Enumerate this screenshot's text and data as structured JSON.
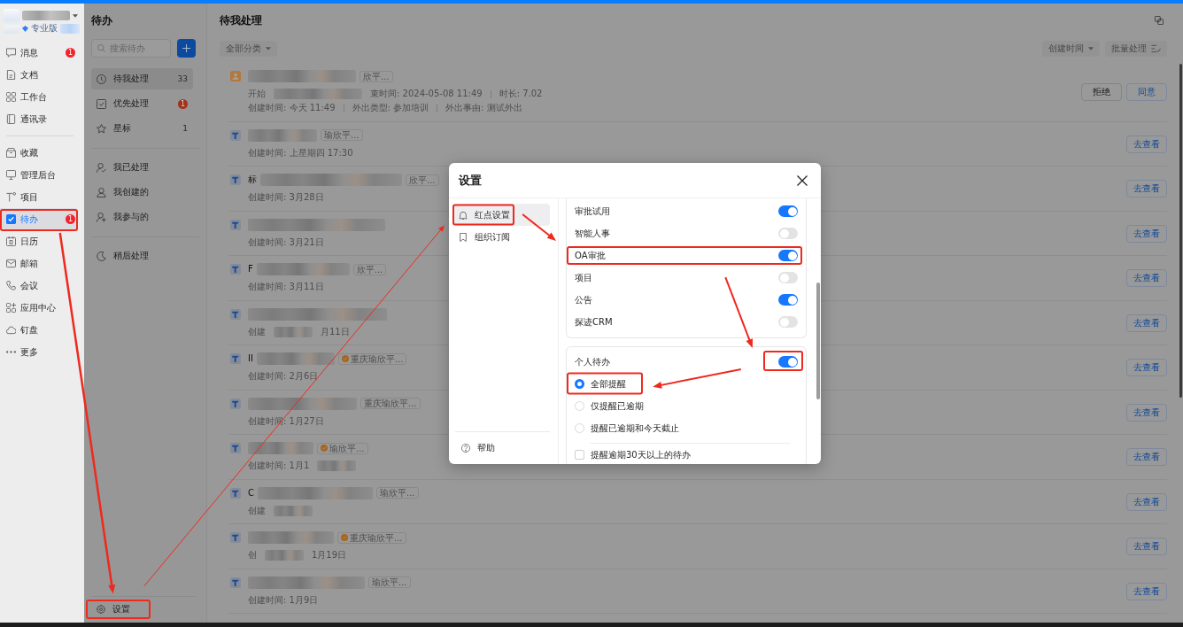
{
  "org": {
    "edition": "专业版"
  },
  "sidebar": {
    "groups": [
      [
        {
          "label": "消息",
          "badge": "1",
          "selected": false,
          "highlighted": false
        },
        {
          "label": "文档",
          "selected": false,
          "highlighted": false
        },
        {
          "label": "工作台",
          "selected": false,
          "highlighted": false
        },
        {
          "label": "通讯录",
          "selected": false,
          "highlighted": false
        }
      ],
      [
        {
          "label": "收藏",
          "selected": false,
          "highlighted": false
        },
        {
          "label": "管理后台",
          "selected": false,
          "highlighted": false
        },
        {
          "label": "项目",
          "selected": false,
          "highlighted": false
        },
        {
          "label": "待办",
          "badge": "1",
          "selected": true,
          "highlighted": true
        },
        {
          "label": "日历",
          "selected": false,
          "highlighted": false
        },
        {
          "label": "邮箱",
          "selected": false,
          "highlighted": false
        },
        {
          "label": "会议",
          "selected": false,
          "highlighted": false
        },
        {
          "label": "应用中心",
          "selected": false,
          "highlighted": false
        },
        {
          "label": "钉盘",
          "selected": false,
          "highlighted": false
        },
        {
          "label": "更多",
          "selected": false,
          "highlighted": false
        }
      ]
    ]
  },
  "todo_nav": {
    "title": "待办",
    "search": {
      "placeholder": "搜索待办"
    },
    "groups": [
      [
        {
          "label": "待我处理",
          "count": "33",
          "selected": true
        },
        {
          "label": "优先处理",
          "badge": "1",
          "selected": false
        },
        {
          "label": "星标",
          "count": "1",
          "selected": false
        }
      ],
      [
        {
          "label": "我已处理",
          "selected": false
        },
        {
          "label": "我创建的",
          "selected": false
        },
        {
          "label": "我参与的",
          "selected": false
        }
      ],
      [
        {
          "label": "稍后处理",
          "selected": false
        }
      ]
    ],
    "settings": {
      "label": "设置",
      "highlighted": true
    }
  },
  "main": {
    "title": "待我处理",
    "filter": "全部分类",
    "sort": "创建时间",
    "batch": "批量处理",
    "rows": [
      {
        "kind": "person",
        "title": [
          {
            "kind": "blur"
          }
        ],
        "tag": {
          "text": "欣平...",
          "org": false
        },
        "meta": [
          [
            {
              "kind": "text",
              "text": "开始"
            },
            {
              "kind": "blur"
            },
            {
              "kind": "text",
              "text": "束时间: 2024-05-08 11:49"
            },
            {
              "kind": "sep"
            },
            {
              "kind": "text",
              "text": "时长: 7.02"
            }
          ],
          [
            {
              "kind": "text",
              "text": "创建时间: 今天 11:49"
            },
            {
              "kind": "sep"
            },
            {
              "kind": "text",
              "text": "外出类型: 参加培训"
            },
            {
              "kind": "sep"
            },
            {
              "kind": "text",
              "text": "外出事由: 测试外出"
            }
          ]
        ],
        "actions": [
          {
            "label": "拒绝",
            "kind": "default"
          },
          {
            "label": "同意",
            "kind": "primary"
          }
        ]
      },
      {
        "kind": "app",
        "title": [
          {
            "kind": "blur"
          }
        ],
        "tag": {
          "text": "瑜欣平...",
          "org": false
        },
        "meta": [
          [
            {
              "kind": "text",
              "text": "创建时间: 上星期四 17:30"
            }
          ]
        ],
        "actions": [
          {
            "label": "去查看",
            "kind": "primary"
          }
        ]
      },
      {
        "kind": "app",
        "title": [
          {
            "kind": "text",
            "text": "标"
          },
          {
            "kind": "blur"
          }
        ],
        "tag": {
          "text": "欣平...",
          "org": false
        },
        "meta": [
          [
            {
              "kind": "text",
              "text": "创建时间: 3月28日"
            }
          ]
        ],
        "actions": [
          {
            "label": "去查看",
            "kind": "primary"
          }
        ]
      },
      {
        "kind": "app",
        "title": [
          {
            "kind": "blur"
          }
        ],
        "meta": [
          [
            {
              "kind": "text",
              "text": "创建时间: 3月21日"
            }
          ]
        ],
        "actions": [
          {
            "label": "去查看",
            "kind": "primary"
          }
        ]
      },
      {
        "kind": "app",
        "title": [
          {
            "kind": "text",
            "text": "F"
          },
          {
            "kind": "blur"
          }
        ],
        "tag": {
          "text": "欣平...",
          "org": false
        },
        "meta": [
          [
            {
              "kind": "text",
              "text": "创建时间: 3月11日"
            }
          ]
        ],
        "actions": [
          {
            "label": "去查看",
            "kind": "primary"
          }
        ]
      },
      {
        "kind": "app",
        "title": [
          {
            "kind": "blur"
          }
        ],
        "meta": [
          [
            {
              "kind": "text",
              "text": "创建"
            },
            {
              "kind": "blur"
            },
            {
              "kind": "text",
              "text": "月11日"
            }
          ]
        ],
        "actions": [
          {
            "label": "去查看",
            "kind": "primary"
          }
        ]
      },
      {
        "kind": "app",
        "title": [
          {
            "kind": "text",
            "text": "II"
          },
          {
            "kind": "blur"
          }
        ],
        "tag": {
          "text": "重庆瑜欣平...",
          "org": true
        },
        "meta": [
          [
            {
              "kind": "text",
              "text": "创建时间: 2月6日"
            }
          ]
        ],
        "actions": [
          {
            "label": "去查看",
            "kind": "primary"
          }
        ]
      },
      {
        "kind": "app",
        "title": [
          {
            "kind": "blur"
          }
        ],
        "tag": {
          "text": "重庆瑜欣平...",
          "org": false
        },
        "meta": [
          [
            {
              "kind": "text",
              "text": "创建时间: 1月27日"
            }
          ]
        ],
        "actions": [
          {
            "label": "去查看",
            "kind": "primary"
          }
        ]
      },
      {
        "kind": "app",
        "title": [
          {
            "kind": "blur"
          }
        ],
        "tag": {
          "text": "瑜欣平...",
          "org": true
        },
        "meta": [
          [
            {
              "kind": "text",
              "text": "创建时间: 1月1"
            },
            {
              "kind": "blur"
            }
          ]
        ],
        "actions": [
          {
            "label": "去查看",
            "kind": "primary"
          }
        ]
      },
      {
        "kind": "app",
        "title": [
          {
            "kind": "text",
            "text": "C"
          },
          {
            "kind": "blur"
          }
        ],
        "tag": {
          "text": "瑜欣平...",
          "org": false
        },
        "meta": [
          [
            {
              "kind": "text",
              "text": "创建"
            },
            {
              "kind": "blur"
            }
          ]
        ],
        "actions": [
          {
            "label": "去查看",
            "kind": "primary"
          }
        ]
      },
      {
        "kind": "app",
        "title": [
          {
            "kind": "blur"
          }
        ],
        "tag": {
          "text": "重庆瑜欣平...",
          "org": true
        },
        "meta": [
          [
            {
              "kind": "text",
              "text": "创"
            },
            {
              "kind": "blur"
            },
            {
              "kind": "text",
              "text": "1月19日"
            }
          ]
        ],
        "actions": [
          {
            "label": "去查看",
            "kind": "primary"
          }
        ]
      },
      {
        "kind": "app",
        "title": [
          {
            "kind": "blur"
          }
        ],
        "tag": {
          "text": "瑜欣平...",
          "org": false
        },
        "meta": [
          [
            {
              "kind": "text",
              "text": "创建时间: 1月9日"
            }
          ]
        ],
        "actions": [
          {
            "label": "去查看",
            "kind": "primary"
          }
        ]
      }
    ]
  },
  "dialog": {
    "title": "设置",
    "nav": [
      {
        "label": "红点设置",
        "selected": true,
        "highlighted": true
      },
      {
        "label": "组织订阅",
        "selected": false,
        "highlighted": false
      }
    ],
    "help": "帮助",
    "apps": [
      {
        "label": "审批试用",
        "on": true,
        "highlighted": false
      },
      {
        "label": "智能人事",
        "on": false,
        "highlighted": false
      },
      {
        "label": "OA审批",
        "on": true,
        "highlighted": true
      },
      {
        "label": "项目",
        "on": false,
        "highlighted": false
      },
      {
        "label": "公告",
        "on": true,
        "highlighted": false
      },
      {
        "label": "探迹CRM",
        "on": false,
        "highlighted": false
      }
    ],
    "personal": {
      "label": "个人待办",
      "on": true,
      "highlighted": true,
      "options": [
        {
          "label": "全部提醒",
          "selected": true,
          "highlighted": true
        },
        {
          "label": "仅提醒已逾期",
          "selected": false,
          "highlighted": false
        },
        {
          "label": "提醒已逾期和今天截止",
          "selected": false,
          "highlighted": false
        }
      ],
      "overdue": {
        "label": "提醒逾期30天以上的待办",
        "checked": false
      }
    }
  }
}
